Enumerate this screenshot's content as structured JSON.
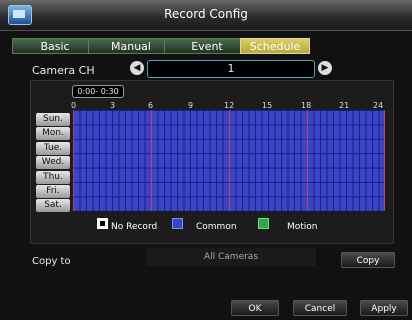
{
  "window": {
    "title": "Record Config",
    "icon": "dvr-app-icon"
  },
  "tabs": [
    {
      "label": "Basic",
      "active": false
    },
    {
      "label": "Manual",
      "active": false
    },
    {
      "label": "Event",
      "active": false
    },
    {
      "label": "Schedule",
      "active": true
    }
  ],
  "camera": {
    "label": "Camera CH",
    "value": "1",
    "prev_icon": "arrow-left-icon",
    "next_icon": "arrow-right-icon"
  },
  "schedule": {
    "time_tip": "0:00- 0:30",
    "hours": [
      "0",
      "3",
      "6",
      "9",
      "12",
      "15",
      "18",
      "21",
      "24"
    ],
    "days": [
      "Sun.",
      "Mon.",
      "Tue.",
      "Wed.",
      "Thu.",
      "Fri.",
      "Sat."
    ],
    "legend": {
      "no_record": "No Record",
      "common": "Common",
      "motion": "Motion"
    },
    "colors": {
      "common": "#3a45c8",
      "motion": "#2fa84a",
      "no_record": "#ffffff"
    }
  },
  "copy": {
    "label": "Copy to",
    "selected": "All Cameras",
    "button": "Copy"
  },
  "footer": {
    "ok": "OK",
    "cancel": "Cancel",
    "apply": "Apply"
  }
}
